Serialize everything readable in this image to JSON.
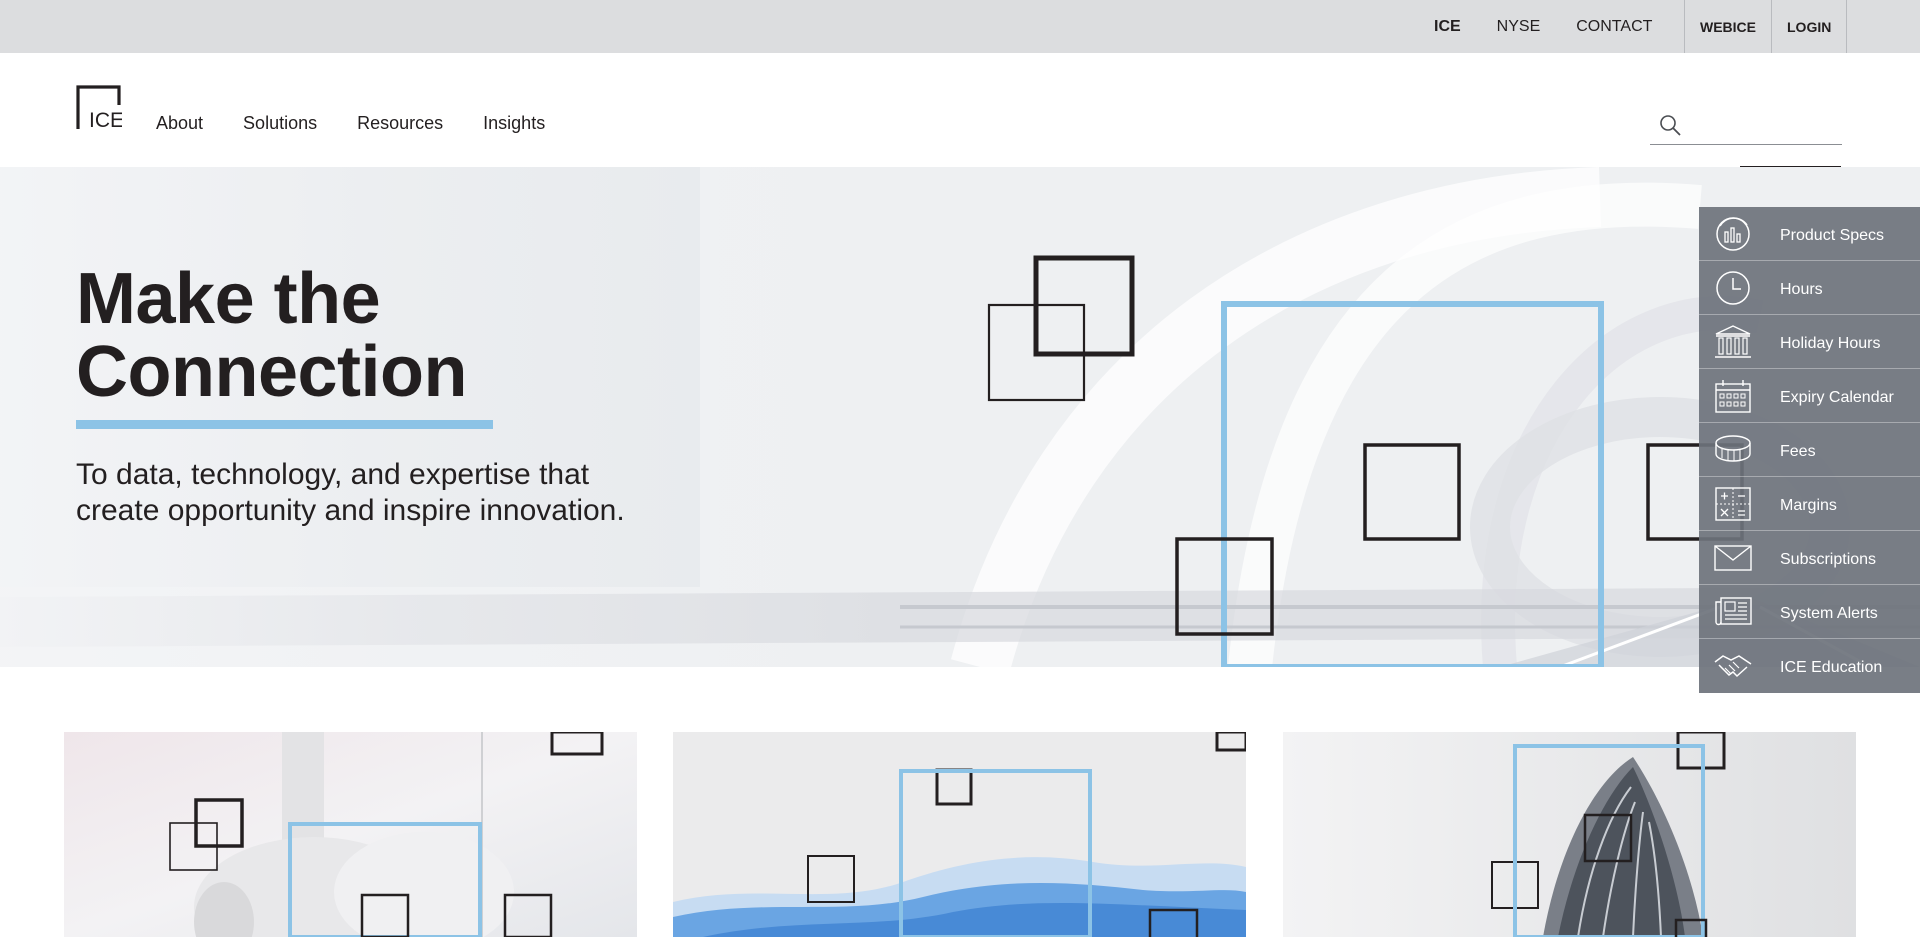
{
  "utility_bar": {
    "links": [
      "ICE",
      "NYSE",
      "CONTACT"
    ],
    "right_links": [
      "WEBICE",
      "LOGIN"
    ]
  },
  "header": {
    "logo_text": "ICE",
    "nav": [
      "About",
      "Solutions",
      "Resources",
      "Insights"
    ],
    "search": {
      "placeholder": "",
      "value": ""
    }
  },
  "hero": {
    "title_line1": "Make the",
    "title_line2": "Connection",
    "subtitle": "To data, technology, and expertise that create opportunity and inspire innovation."
  },
  "quick_links": [
    {
      "label": "Product Specs",
      "icon": "product-specs-icon"
    },
    {
      "label": "Hours",
      "icon": "clock-icon"
    },
    {
      "label": "Holiday Hours",
      "icon": "bank-building-icon"
    },
    {
      "label": "Expiry Calendar",
      "icon": "calendar-icon"
    },
    {
      "label": "Fees",
      "icon": "coins-icon"
    },
    {
      "label": "Margins",
      "icon": "calculator-icon"
    },
    {
      "label": "Subscriptions",
      "icon": "envelope-icon"
    },
    {
      "label": "System Alerts",
      "icon": "newspaper-icon"
    },
    {
      "label": "ICE Education",
      "icon": "handshake-icon"
    }
  ],
  "colors": {
    "accent_blue": "#8cc3e6",
    "text_dark": "#231f20",
    "utility_bar_bg": "#dcdddf",
    "panel_bg": "#6e737c"
  }
}
